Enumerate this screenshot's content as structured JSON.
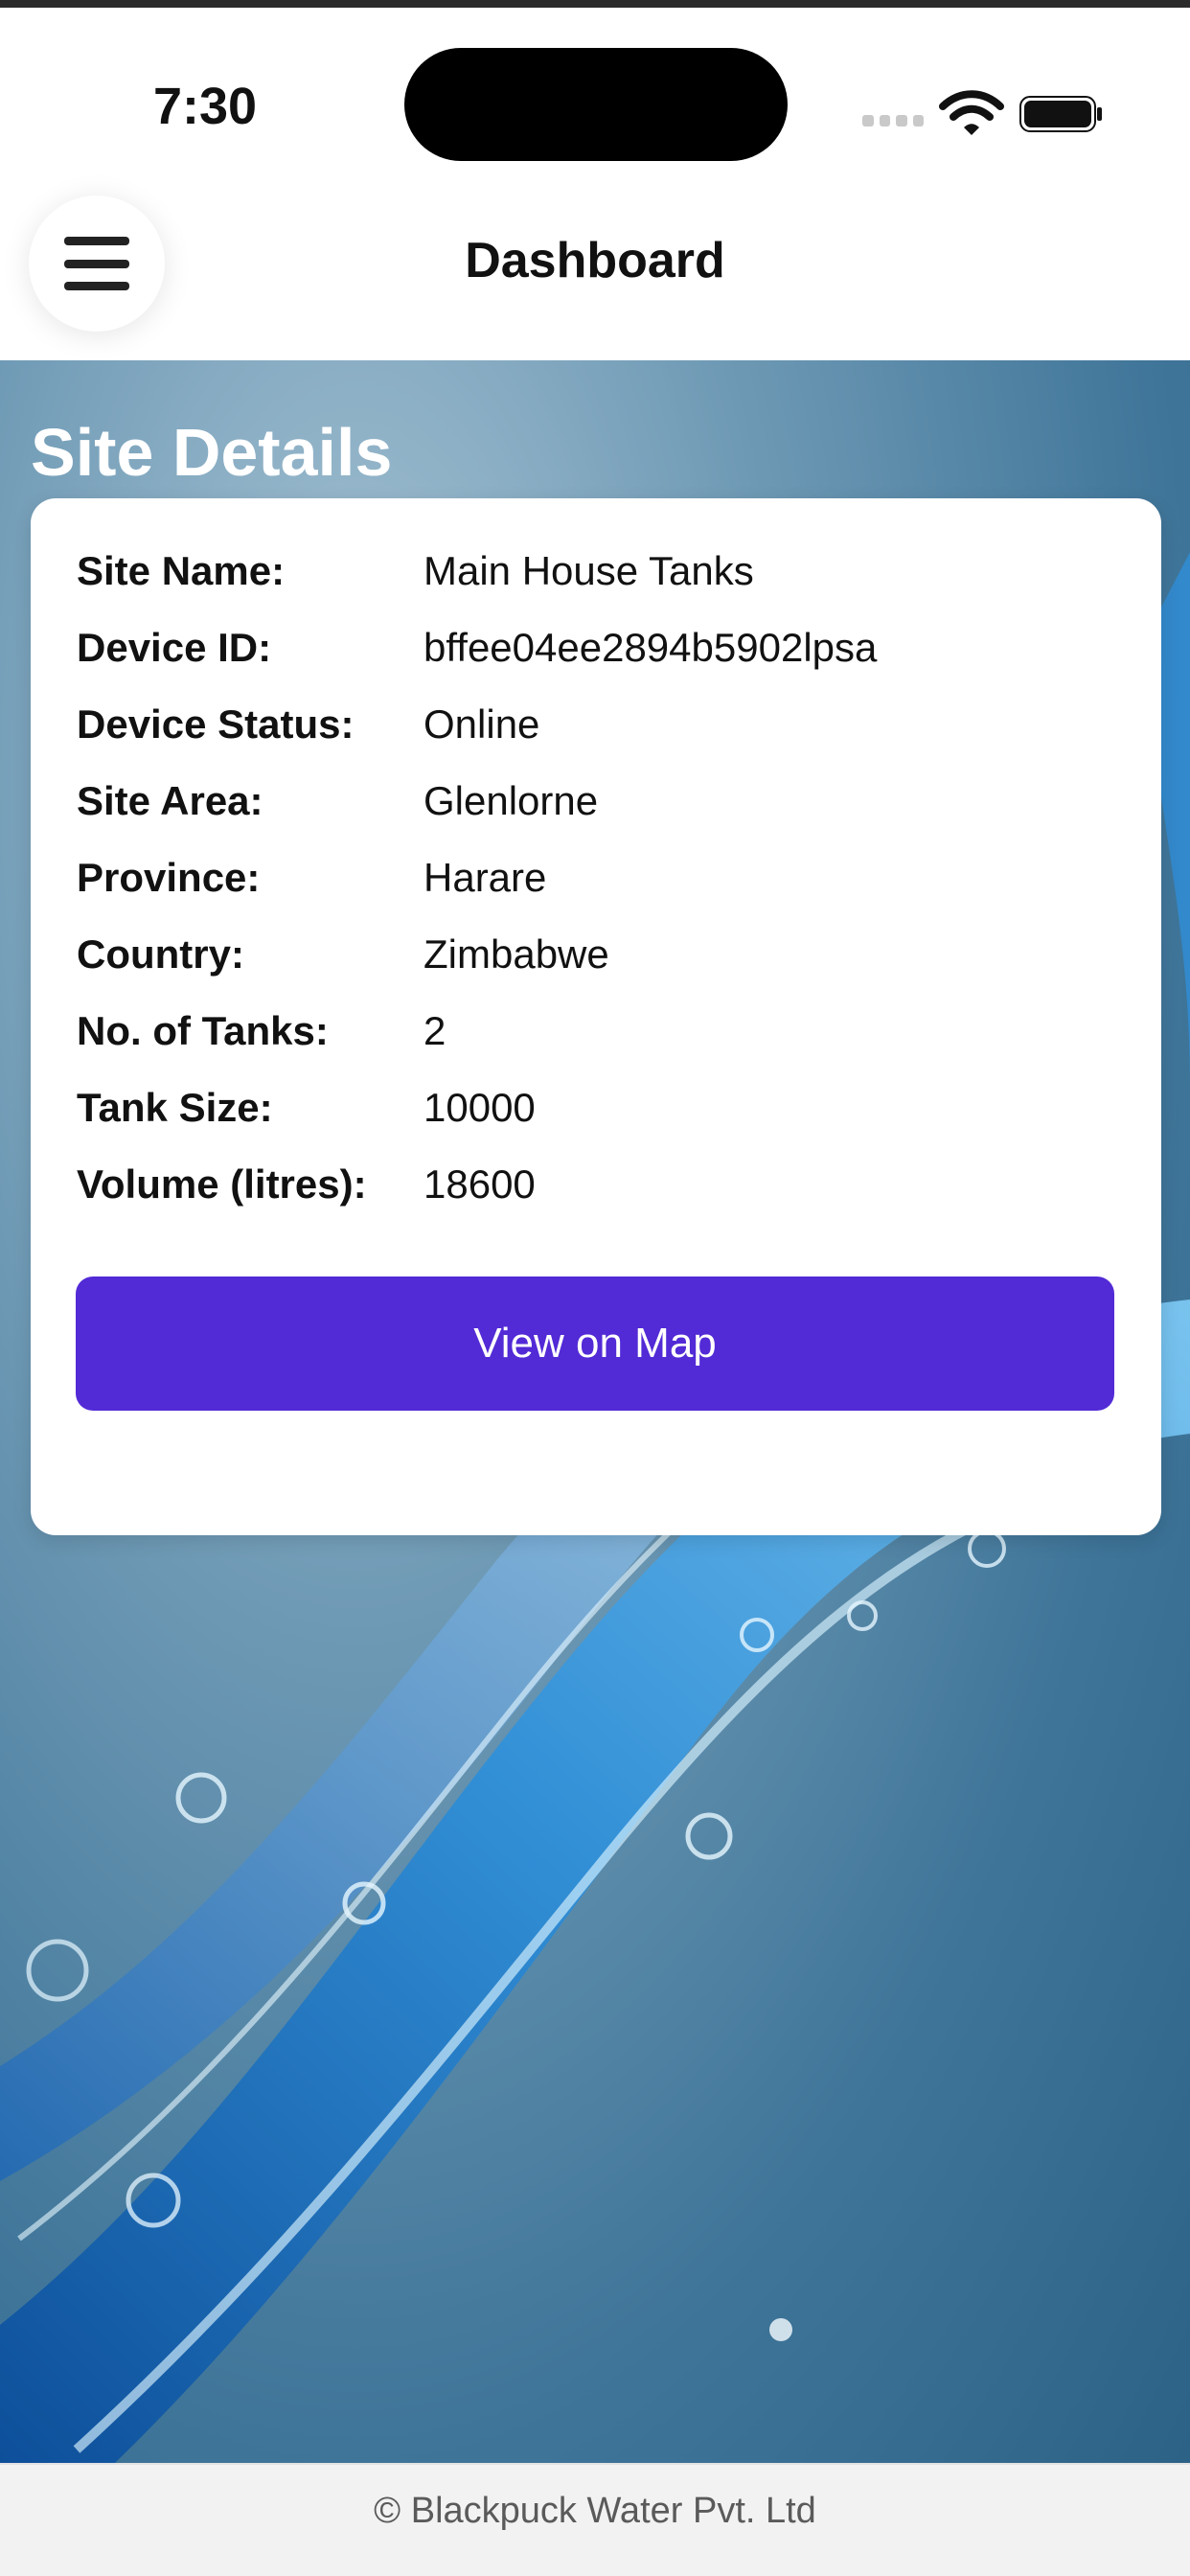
{
  "status_bar": {
    "time": "7:30",
    "icons": [
      "signal-icon",
      "wifi-icon",
      "battery-icon"
    ]
  },
  "header": {
    "title": "Dashboard",
    "menu_icon": "hamburger-menu-icon"
  },
  "section": {
    "title": "Site Details"
  },
  "details": [
    {
      "label": "Site Name:",
      "value": "Main House Tanks"
    },
    {
      "label": "Device ID:",
      "value": "bffee04ee2894b5902lpsa"
    },
    {
      "label": "Device Status:",
      "value": "Online"
    },
    {
      "label": "Site Area:",
      "value": "Glenlorne"
    },
    {
      "label": "Province:",
      "value": "Harare"
    },
    {
      "label": "Country:",
      "value": "Zimbabwe"
    },
    {
      "label": "No. of Tanks:",
      "value": "2"
    },
    {
      "label": "Tank Size:",
      "value": "10000"
    },
    {
      "label": "Volume (litres):",
      "value": "18600"
    }
  ],
  "map_button": {
    "label": "View on Map"
  },
  "footer": {
    "text": "© Blackpuck Water Pvt. Ltd"
  },
  "colors": {
    "accent": "#522ad6",
    "background_water": "#3f7599",
    "card": "#ffffff"
  }
}
